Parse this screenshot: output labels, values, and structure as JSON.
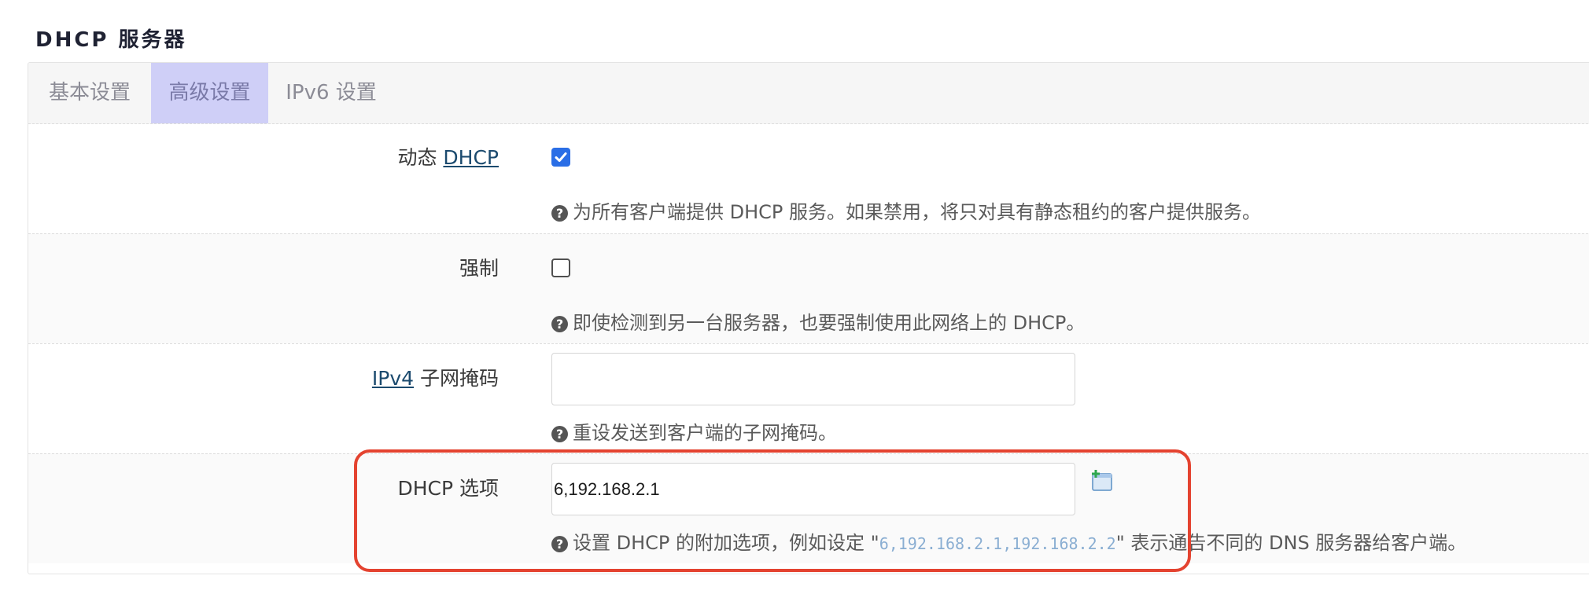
{
  "section": {
    "title": "DHCP 服务器"
  },
  "tabs": [
    {
      "label": "基本设置",
      "active": false
    },
    {
      "label": "高级设置",
      "active": true
    },
    {
      "label": "IPv6 设置",
      "active": false
    }
  ],
  "dynamic_dhcp": {
    "label_prefix": "动态 ",
    "label_link": "DHCP",
    "checked": true,
    "help": "为所有客户端提供 DHCP 服务。如果禁用，将只对具有静态租约的客户提供服务。"
  },
  "force": {
    "label": "强制",
    "checked": false,
    "help": "即使检测到另一台服务器，也要强制使用此网络上的 DHCP。"
  },
  "netmask": {
    "label_link": "IPv4",
    "label_suffix": " 子网掩码",
    "value": "",
    "help": "重设发送到客户端的子网掩码。"
  },
  "dhcp_options": {
    "label": "DHCP 选项",
    "value": "6,192.168.2.1",
    "help_prefix": "设置 DHCP 的附加选项，例如设定 \"",
    "help_code": "6,192.168.2.1,192.168.2.2",
    "help_suffix": "\" 表示通告不同的 DNS 服务器给客户端。",
    "add_icon": "add-field-icon"
  },
  "icons": {
    "help": "question-circle-icon"
  },
  "colors": {
    "active_tab_bg": "#cfcff7",
    "checkbox_checked": "#2a6ee6",
    "link": "#1b4a6e",
    "highlight_border": "#e44330",
    "code_text": "#8aaed2"
  }
}
